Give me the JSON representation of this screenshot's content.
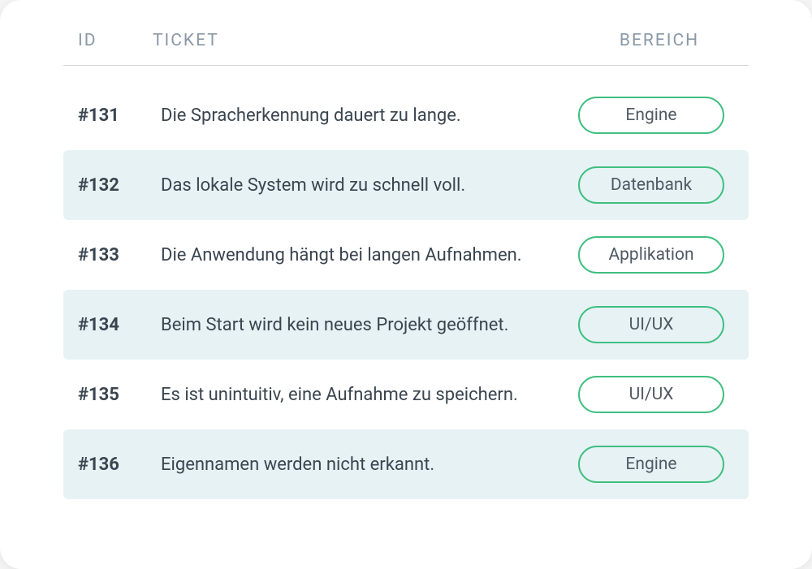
{
  "table": {
    "headers": {
      "id": "ID",
      "ticket": "TICKET",
      "bereich": "BEREICH"
    },
    "rows": [
      {
        "id": "#131",
        "ticket": "Die Spracherkennung dauert zu lange.",
        "bereich": "Engine"
      },
      {
        "id": "#132",
        "ticket": "Das lokale System wird zu schnell voll.",
        "bereich": "Datenbank"
      },
      {
        "id": "#133",
        "ticket": "Die Anwendung hängt bei langen Aufnahmen.",
        "bereich": "Applikation"
      },
      {
        "id": "#134",
        "ticket": "Beim Start wird kein neues Projekt geöffnet.",
        "bereich": "UI/UX"
      },
      {
        "id": "#135",
        "ticket": "Es ist unintuitiv, eine Aufnahme zu speichern.",
        "bereich": "UI/UX"
      },
      {
        "id": "#136",
        "ticket": "Eigennamen werden nicht erkannt.",
        "bereich": "Engine"
      }
    ]
  }
}
